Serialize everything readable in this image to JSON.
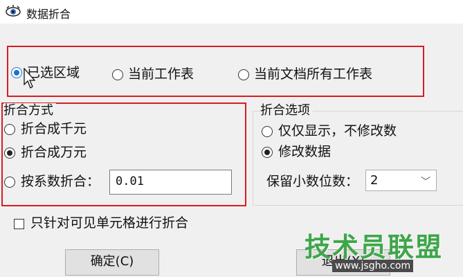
{
  "window": {
    "title": "数据折合",
    "app_icon": "eye-app-icon"
  },
  "scope": {
    "options": [
      {
        "label": "已选区域",
        "checked": true
      },
      {
        "label": "当前工作表",
        "checked": false
      },
      {
        "label": "当前文档所有工作表",
        "checked": false
      }
    ]
  },
  "method": {
    "title": "折合方式",
    "options": [
      {
        "label": "折合成千元",
        "checked": false
      },
      {
        "label": "折合成万元",
        "checked": true
      },
      {
        "label": "按系数折合：",
        "checked": false
      }
    ],
    "coefficient_value": "0.01"
  },
  "fold_options": {
    "title": "折合选项",
    "options": [
      {
        "label": "仅仅显示，不修改数",
        "checked": false
      },
      {
        "label": "修改数据",
        "checked": true
      }
    ],
    "decimals_label": "保留小数位数：",
    "decimals_value": "2"
  },
  "visible_only": {
    "label": "只针对可见单元格进行折合",
    "checked": false
  },
  "buttons": {
    "ok": "确定(C)",
    "exit": "退出(X)"
  },
  "watermark": {
    "text": "技术员联盟",
    "url": "www.jsgho.com"
  },
  "colors": {
    "annotation_red": "#d81b24",
    "selected_blue": "#1e6fd0",
    "watermark_green": "#3ea64a"
  }
}
